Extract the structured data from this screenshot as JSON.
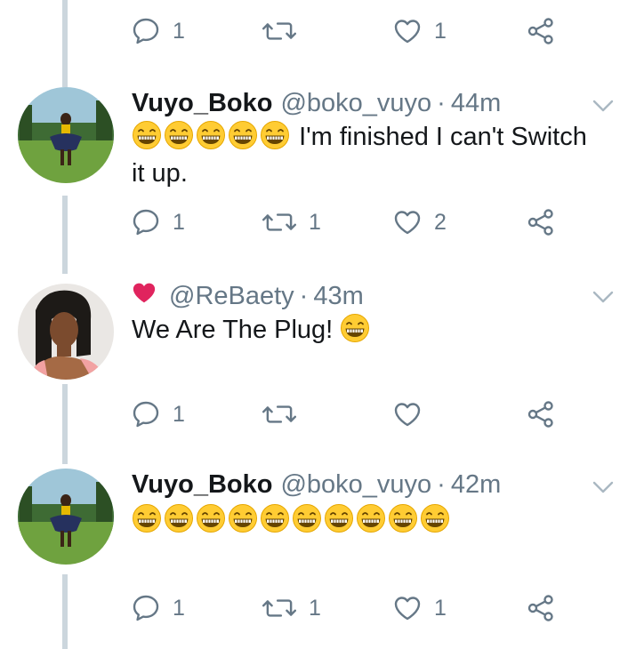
{
  "thread": {
    "top_actions": {
      "reply": "1",
      "retweet": "",
      "like": "1"
    },
    "tweets": [
      {
        "display_name": "Vuyo_Boko",
        "handle": "@boko_vuyo",
        "separator": "·",
        "time": "44m",
        "text": "I'm finished I can't Switch it up.",
        "emoji_count": 5,
        "actions": {
          "reply": "1",
          "retweet": "1",
          "like": "2"
        }
      },
      {
        "liked_by_icon": "pink-heart-icon",
        "handle": "@ReBaety",
        "separator": "·",
        "time": "43m",
        "text": "We Are The Plug!",
        "emoji_count": 1,
        "actions": {
          "reply": "1",
          "retweet": "",
          "like": ""
        }
      },
      {
        "display_name": "Vuyo_Boko",
        "handle": "@boko_vuyo",
        "separator": "·",
        "time": "42m",
        "text": "",
        "emoji_count": 10,
        "actions": {
          "reply": "1",
          "retweet": "1",
          "like": "1"
        }
      }
    ]
  },
  "icons": {
    "reply": "reply-icon",
    "retweet": "retweet-icon",
    "like": "heart-icon",
    "share": "share-icon",
    "menu": "chevron-down-icon",
    "emoji": "grinning-emoji-icon"
  },
  "colors": {
    "text": "#14171a",
    "secondary": "#657786",
    "thread_line": "#ccd6dd",
    "liked_heart": "#e0245e",
    "emoji_yellow": "#ffcc33"
  }
}
